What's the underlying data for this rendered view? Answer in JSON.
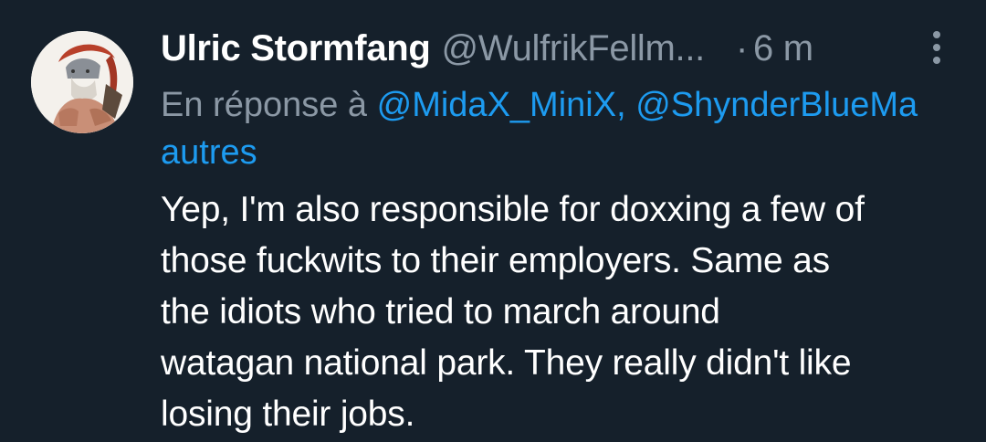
{
  "tweet": {
    "author_name": "Ulric Stormfang",
    "author_handle": "@WulfrikFellm...",
    "separator": "·",
    "time": "6 m",
    "more_icon": "vertical-ellipsis-icon",
    "reply_prefix": "En réponse à",
    "reply_mentions": [
      "@MidaX_MiniX,",
      "@ShynderBlueMa"
    ],
    "reply_more": "autres",
    "body_lines": [
      "Yep, I'm also responsible for doxxing a few of",
      "those fuckwits to their employers. Same as",
      "the idiots who tried to march around",
      "watagan national park. They really didn't like",
      "losing their jobs."
    ]
  },
  "colors": {
    "background": "#15202b",
    "text_primary": "#ffffff",
    "text_secondary": "#8b98a5",
    "link": "#1d9bf0"
  }
}
